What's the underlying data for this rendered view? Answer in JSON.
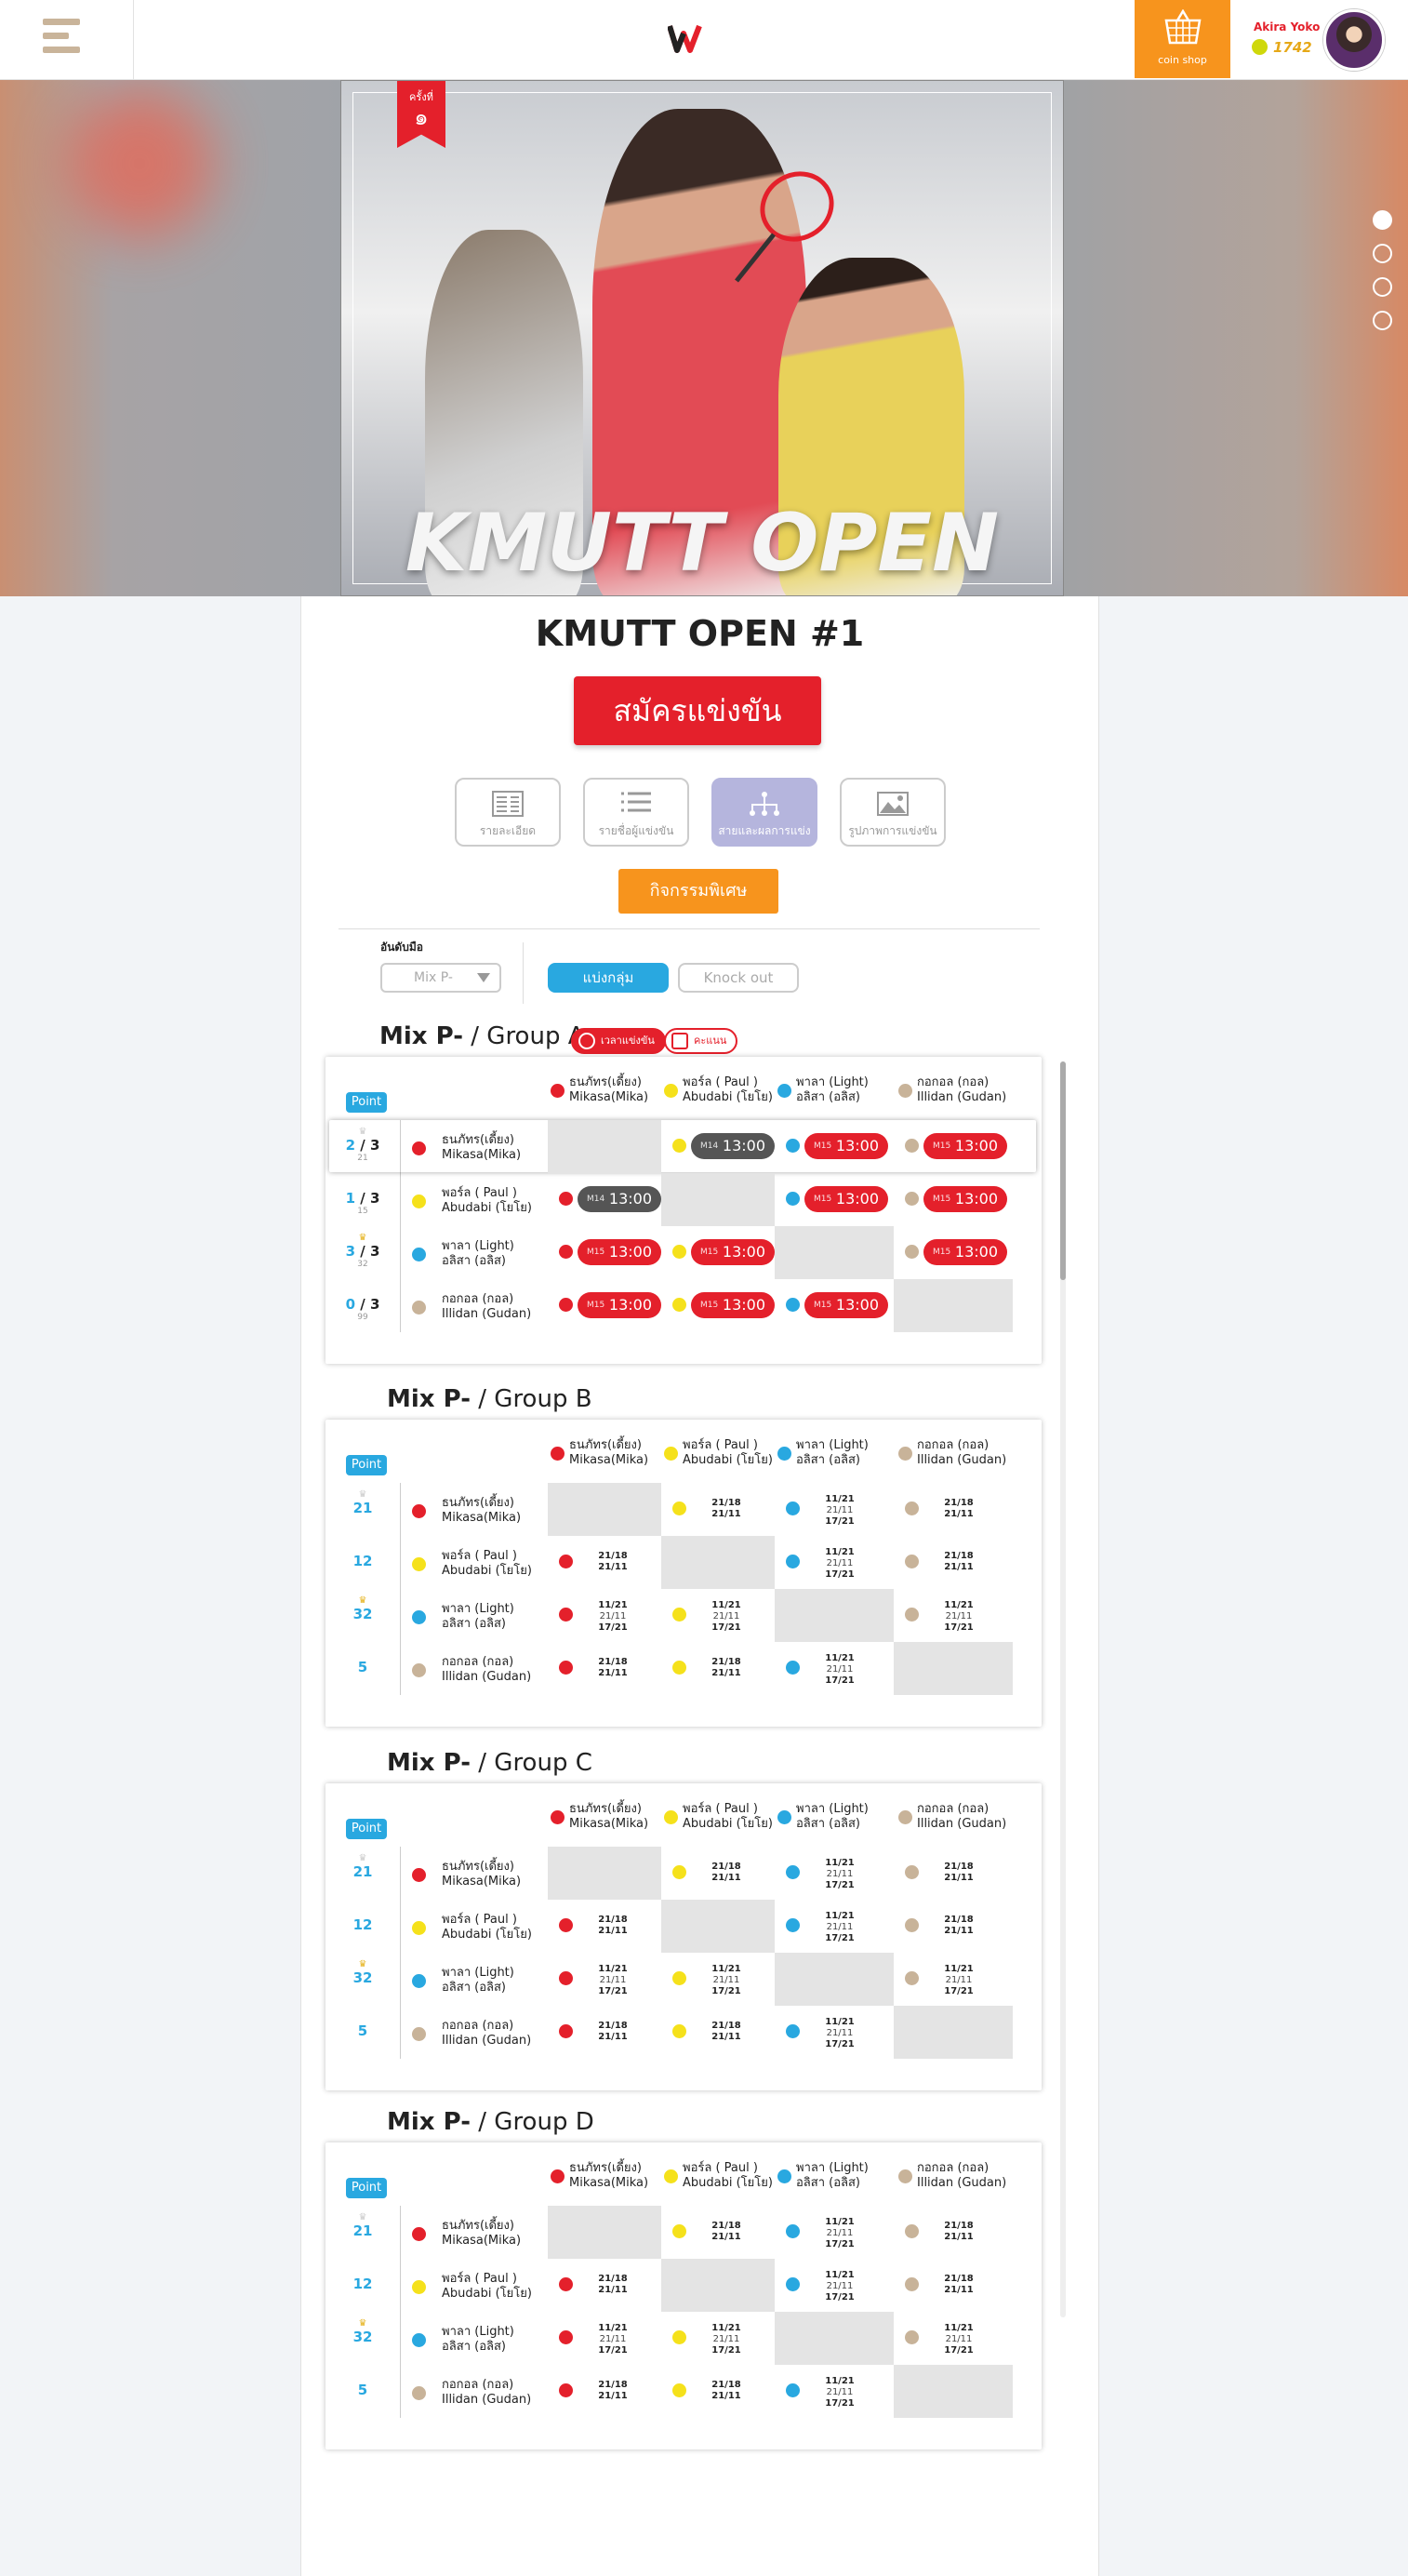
{
  "header": {
    "coin_shop_label": "coin shop",
    "user_name": "Akira Yoko",
    "user_coins": "1742"
  },
  "hero": {
    "ribbon_label": "ครั้งที่",
    "ribbon_number": "๑",
    "poster_title": "KMUTT OPEN"
  },
  "page": {
    "title": "KMUTT OPEN #1",
    "register_label": "สมัครแข่งขัน",
    "tabs": [
      {
        "label": "รายละเอียด",
        "icon": "details-icon"
      },
      {
        "label": "รายชื่อผู้แข่งขัน",
        "icon": "list-icon"
      },
      {
        "label": "สายและผลการแข่ง",
        "icon": "bracket-icon"
      },
      {
        "label": "รูปภาพการแข่งขัน",
        "icon": "image-icon"
      }
    ],
    "special_label": "กิจกรรมพิเศษ",
    "filter_label": "อันดับมือ",
    "filter_value": "Mix P-",
    "mode_group": "แบ่งกลุ่ม",
    "mode_knockout": "Knock out",
    "legend_time": "เวลาแข่งขัน",
    "legend_score": "คะแนน",
    "point_label": "Point"
  },
  "players": [
    {
      "th": "ธนภัทร(เดี้ยง)",
      "en": "Mikasa(Mika)",
      "color": "#e4202b"
    },
    {
      "th": "พอร์ล ( Paul )",
      "en": "Abudabi (โยโย)",
      "color": "#f5e11b"
    },
    {
      "th": "พาลา (Light)",
      "en": "อลิสา (อลิส)",
      "color": "#29a8e0"
    },
    {
      "th": "กอกอล (กอล)",
      "en": "Illidan (Gudan)",
      "color": "#c8b399"
    }
  ],
  "groups": [
    {
      "prefix": "Mix P-",
      "name": "/ Group A",
      "type": "schedule",
      "rows": [
        {
          "score": "2",
          "total": "/ 3",
          "sub": "21",
          "crown": "gray",
          "cells": [
            null,
            {
              "m": "M14",
              "t": "13:00",
              "dark": true
            },
            {
              "m": "M15",
              "t": "13:00"
            },
            {
              "m": "M15",
              "t": "13:00"
            }
          ]
        },
        {
          "score": "1",
          "total": "/ 3",
          "sub": "15",
          "crown": "",
          "cells": [
            {
              "m": "M14",
              "t": "13:00",
              "dark": true
            },
            null,
            {
              "m": "M15",
              "t": "13:00"
            },
            {
              "m": "M15",
              "t": "13:00"
            }
          ]
        },
        {
          "score": "3",
          "total": "/ 3",
          "sub": "32",
          "crown": "gold",
          "cells": [
            {
              "m": "M15",
              "t": "13:00"
            },
            {
              "m": "M15",
              "t": "13:00"
            },
            null,
            {
              "m": "M15",
              "t": "13:00"
            }
          ]
        },
        {
          "score": "0",
          "total": "/ 3",
          "sub": "99",
          "crown": "",
          "cells": [
            {
              "m": "M15",
              "t": "13:00"
            },
            {
              "m": "M15",
              "t": "13:00"
            },
            {
              "m": "M15",
              "t": "13:00"
            },
            null
          ]
        }
      ]
    },
    {
      "prefix": "Mix P-",
      "name": "/ Group B",
      "type": "results",
      "rows": [
        {
          "score": "21",
          "crown": "gray",
          "cells": [
            null,
            [
              "21/18",
              "21/11"
            ],
            [
              "11/21",
              "21/11",
              "17/21"
            ],
            [
              "21/18",
              "21/11"
            ]
          ]
        },
        {
          "score": "12",
          "crown": "",
          "cells": [
            [
              "21/18",
              "21/11"
            ],
            null,
            [
              "11/21",
              "21/11",
              "17/21"
            ],
            [
              "21/18",
              "21/11"
            ]
          ]
        },
        {
          "score": "32",
          "crown": "gold",
          "cells": [
            [
              "11/21",
              "21/11",
              "17/21"
            ],
            [
              "11/21",
              "21/11",
              "17/21"
            ],
            null,
            [
              "11/21",
              "21/11",
              "17/21"
            ]
          ]
        },
        {
          "score": "5",
          "crown": "",
          "cells": [
            [
              "21/18",
              "21/11"
            ],
            [
              "21/18",
              "21/11"
            ],
            [
              "11/21",
              "21/11",
              "17/21"
            ],
            null
          ]
        }
      ]
    },
    {
      "prefix": "Mix P-",
      "name": "/ Group C",
      "type": "results",
      "rows": [
        {
          "score": "21",
          "crown": "gray",
          "cells": [
            null,
            [
              "21/18",
              "21/11"
            ],
            [
              "11/21",
              "21/11",
              "17/21"
            ],
            [
              "21/18",
              "21/11"
            ]
          ]
        },
        {
          "score": "12",
          "crown": "",
          "cells": [
            [
              "21/18",
              "21/11"
            ],
            null,
            [
              "11/21",
              "21/11",
              "17/21"
            ],
            [
              "21/18",
              "21/11"
            ]
          ]
        },
        {
          "score": "32",
          "crown": "gold",
          "cells": [
            [
              "11/21",
              "21/11",
              "17/21"
            ],
            [
              "11/21",
              "21/11",
              "17/21"
            ],
            null,
            [
              "11/21",
              "21/11",
              "17/21"
            ]
          ]
        },
        {
          "score": "5",
          "crown": "",
          "cells": [
            [
              "21/18",
              "21/11"
            ],
            [
              "21/18",
              "21/11"
            ],
            [
              "11/21",
              "21/11",
              "17/21"
            ],
            null
          ]
        }
      ]
    },
    {
      "prefix": "Mix P-",
      "name": "/ Group D",
      "type": "results",
      "rows": [
        {
          "score": "21",
          "crown": "gray",
          "cells": [
            null,
            [
              "21/18",
              "21/11"
            ],
            [
              "11/21",
              "21/11",
              "17/21"
            ],
            [
              "21/18",
              "21/11"
            ]
          ]
        },
        {
          "score": "12",
          "crown": "",
          "cells": [
            [
              "21/18",
              "21/11"
            ],
            null,
            [
              "11/21",
              "21/11",
              "17/21"
            ],
            [
              "21/18",
              "21/11"
            ]
          ]
        },
        {
          "score": "32",
          "crown": "gold",
          "cells": [
            [
              "11/21",
              "21/11",
              "17/21"
            ],
            [
              "11/21",
              "21/11",
              "17/21"
            ],
            null,
            [
              "11/21",
              "21/11",
              "17/21"
            ]
          ]
        },
        {
          "score": "5",
          "crown": "",
          "cells": [
            [
              "21/18",
              "21/11"
            ],
            [
              "21/18",
              "21/11"
            ],
            [
              "11/21",
              "21/11",
              "17/21"
            ],
            null
          ]
        }
      ]
    }
  ]
}
